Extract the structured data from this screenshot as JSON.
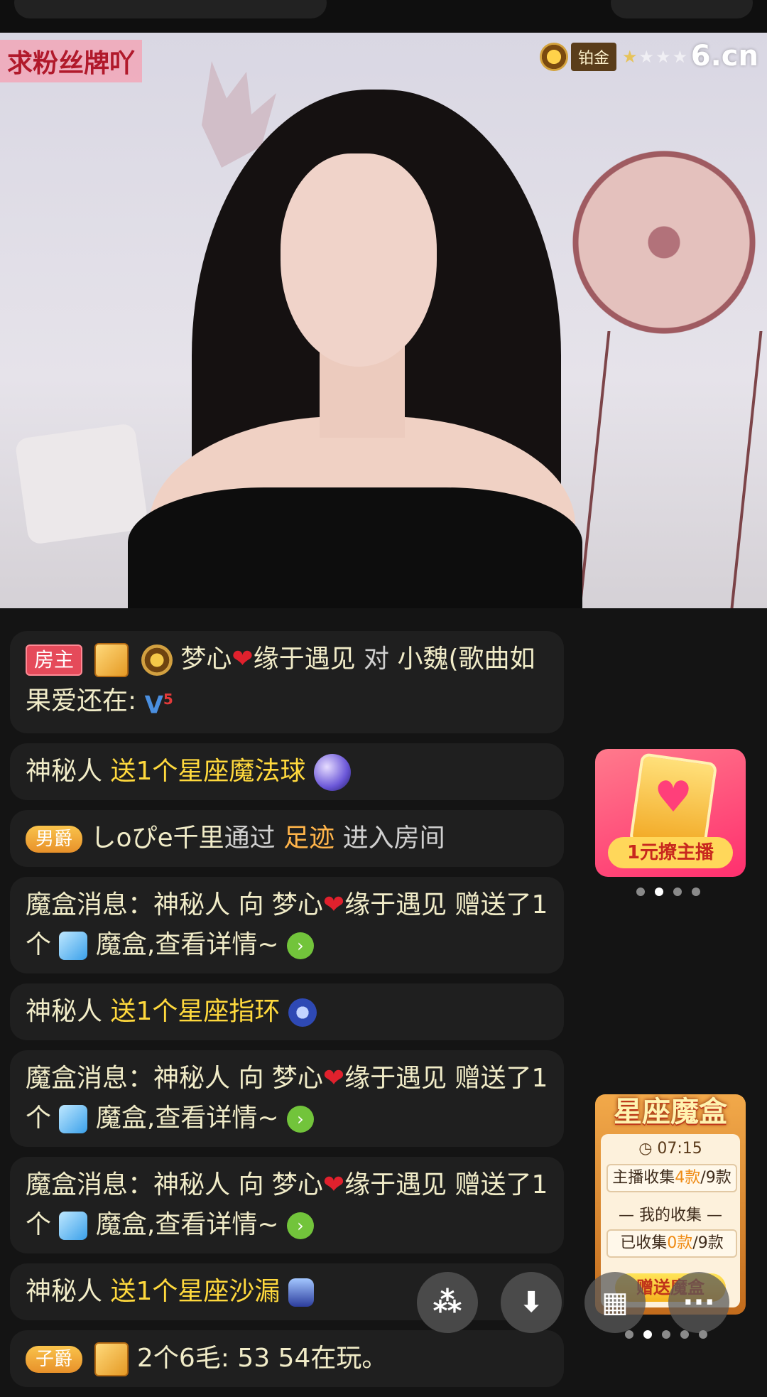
{
  "video": {
    "fan_badge": "求粉丝牌吖",
    "rank_label": "铂金",
    "rank_stars": "★",
    "rank_stars_dim": "★★★",
    "logo": "6.cn"
  },
  "chat": {
    "m1": {
      "tag": "房主",
      "user": "梦心",
      "heart": "❤",
      "user2": "缘于遇见",
      "verb": "对",
      "text": "小魏(歌曲如果爱还在:",
      "level": "V",
      "level_num": "5"
    },
    "m2": {
      "user": "神秘人",
      "gift": "送1个星座魔法球"
    },
    "m3": {
      "tag": "男爵",
      "user": "しoぴe千里",
      "via": "通过",
      "gift": "足迹",
      "text": "进入房间"
    },
    "m4": {
      "a": "魔盒消息：神秘人 向 梦心",
      "heart": "❤",
      "b": "缘于遇见 赠送了1个",
      "c": "魔盒,查看详情~",
      "go": "›"
    },
    "m5": {
      "user": "神秘人",
      "gift": "送1个星座指环"
    },
    "m6": {
      "a": "魔盒消息：神秘人 向 梦心",
      "heart": "❤",
      "b": "缘于遇见 赠送了1个",
      "c": "魔盒,查看详情~",
      "go": "›"
    },
    "m7": {
      "a": "魔盒消息：神秘人 向 梦心",
      "heart": "❤",
      "b": "缘于遇见 赠送了1个",
      "c": "魔盒,查看详情~",
      "go": "›"
    },
    "m8": {
      "user": "神秘人",
      "gift": "送1个星座沙漏"
    },
    "m9": {
      "tag": "子爵",
      "text": "2个6毛: 53 54在玩。"
    }
  },
  "promo": {
    "heart": "♥",
    "label": "1元撩主播"
  },
  "magic_box": {
    "title": "星座魔盒",
    "time": "07:15",
    "anchor_prefix": "主播收集",
    "anchor_count": "4款",
    "anchor_total": "/9款",
    "my_label": "— 我的收集 —",
    "mine_prefix": "已收集",
    "mine_count": "0款",
    "mine_total": "/9款",
    "send_label": "赠送魔盒"
  },
  "fabs": {
    "share": "⁂",
    "download": "⬇",
    "grid": "▦",
    "more": "···"
  },
  "colors": {
    "bg": "#141414",
    "gift_text": "#ffd93d",
    "accent": "#ff2f6e"
  }
}
